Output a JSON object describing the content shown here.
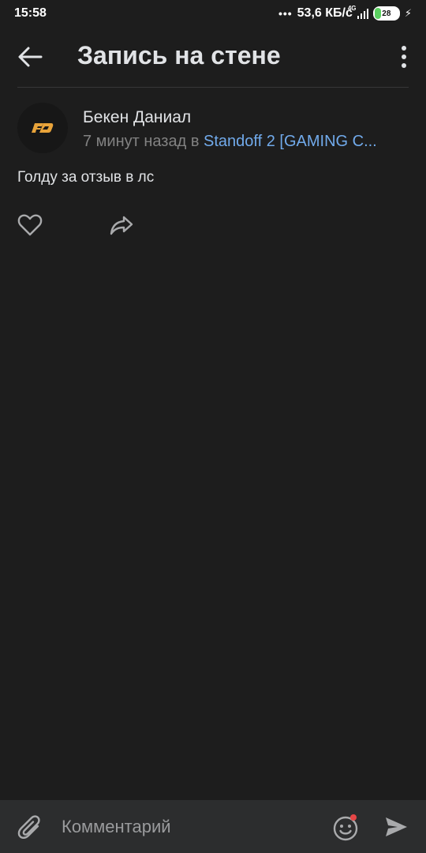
{
  "status_bar": {
    "time": "15:58",
    "dots": "•••",
    "net_speed": "53,6 КБ/с",
    "network_type": "4G",
    "battery_level": "28",
    "battery_fraction": 0.28
  },
  "header": {
    "title": "Запись на стене",
    "back_icon": "arrow-left-icon",
    "more_icon": "more-vertical-icon"
  },
  "post": {
    "author": "Бекен Даниал",
    "time_text": "7 минут назад в",
    "group_name": "Standoff 2 [GAMING C...",
    "text": "Голду за отзыв в лс",
    "like_icon": "heart-icon",
    "share_icon": "share-icon"
  },
  "comment_bar": {
    "placeholder": "Комментарий",
    "attach_icon": "paperclip-icon",
    "emoji_icon": "smile-icon",
    "send_icon": "send-icon"
  },
  "colors": {
    "background": "#1d1d1d",
    "text_primary": "#e1e3e6",
    "text_secondary": "#828282",
    "link": "#71aaeb",
    "avatar_accent": "#e8a33a",
    "notification_dot": "#e64646",
    "bar_background": "#2c2d2e"
  }
}
